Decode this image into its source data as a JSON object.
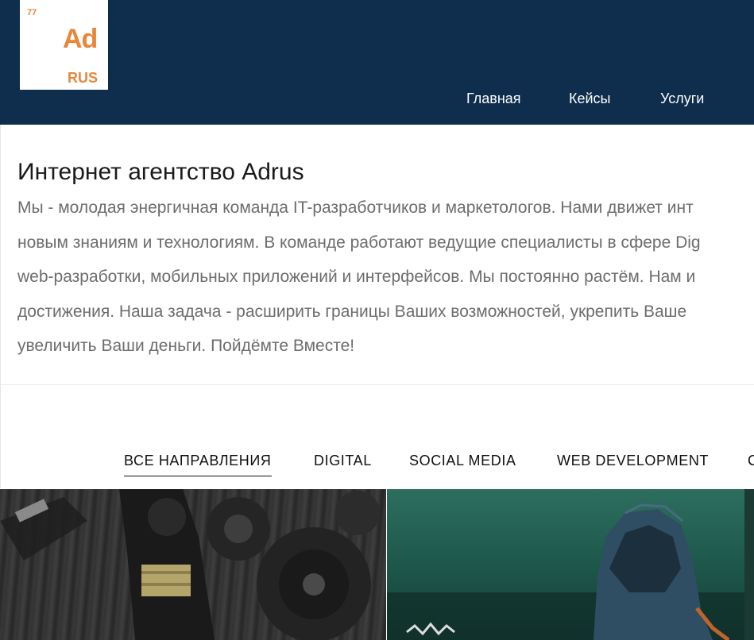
{
  "header": {
    "logo": {
      "number": "77",
      "main": "Ad",
      "sub": "RUS"
    },
    "nav": [
      {
        "label": "Главная"
      },
      {
        "label": "Кейсы"
      },
      {
        "label": "Услуги"
      }
    ]
  },
  "intro": {
    "title": "Интернет агентство Adrus",
    "lines": [
      "Мы - молодая энергичная команда IT-разработчиков и маркетологов. Нами движет инт",
      "новым знаниям и технологиям. В команде работают ведущие специалисты в сфере Dig",
      "web-разработки, мобильных приложений и интерфейсов. Мы постоянно растём. Нам и",
      "достижения. Наша задача - расширить границы Ваших возможностей, укрепить Ваше",
      "увеличить Ваши деньги. Пойдёмте Вместе!"
    ]
  },
  "filters": [
    {
      "label": "ВСЕ НАПРАВЛЕНИЯ",
      "active": true
    },
    {
      "label": "DIGITAL"
    },
    {
      "label": "SOCIAL MEDIA"
    },
    {
      "label": "WEB DEVELOPMENT"
    },
    {
      "label": "C"
    }
  ],
  "colors": {
    "header_bg": "#0f2d4d",
    "logo_accent": "#e8863a"
  }
}
